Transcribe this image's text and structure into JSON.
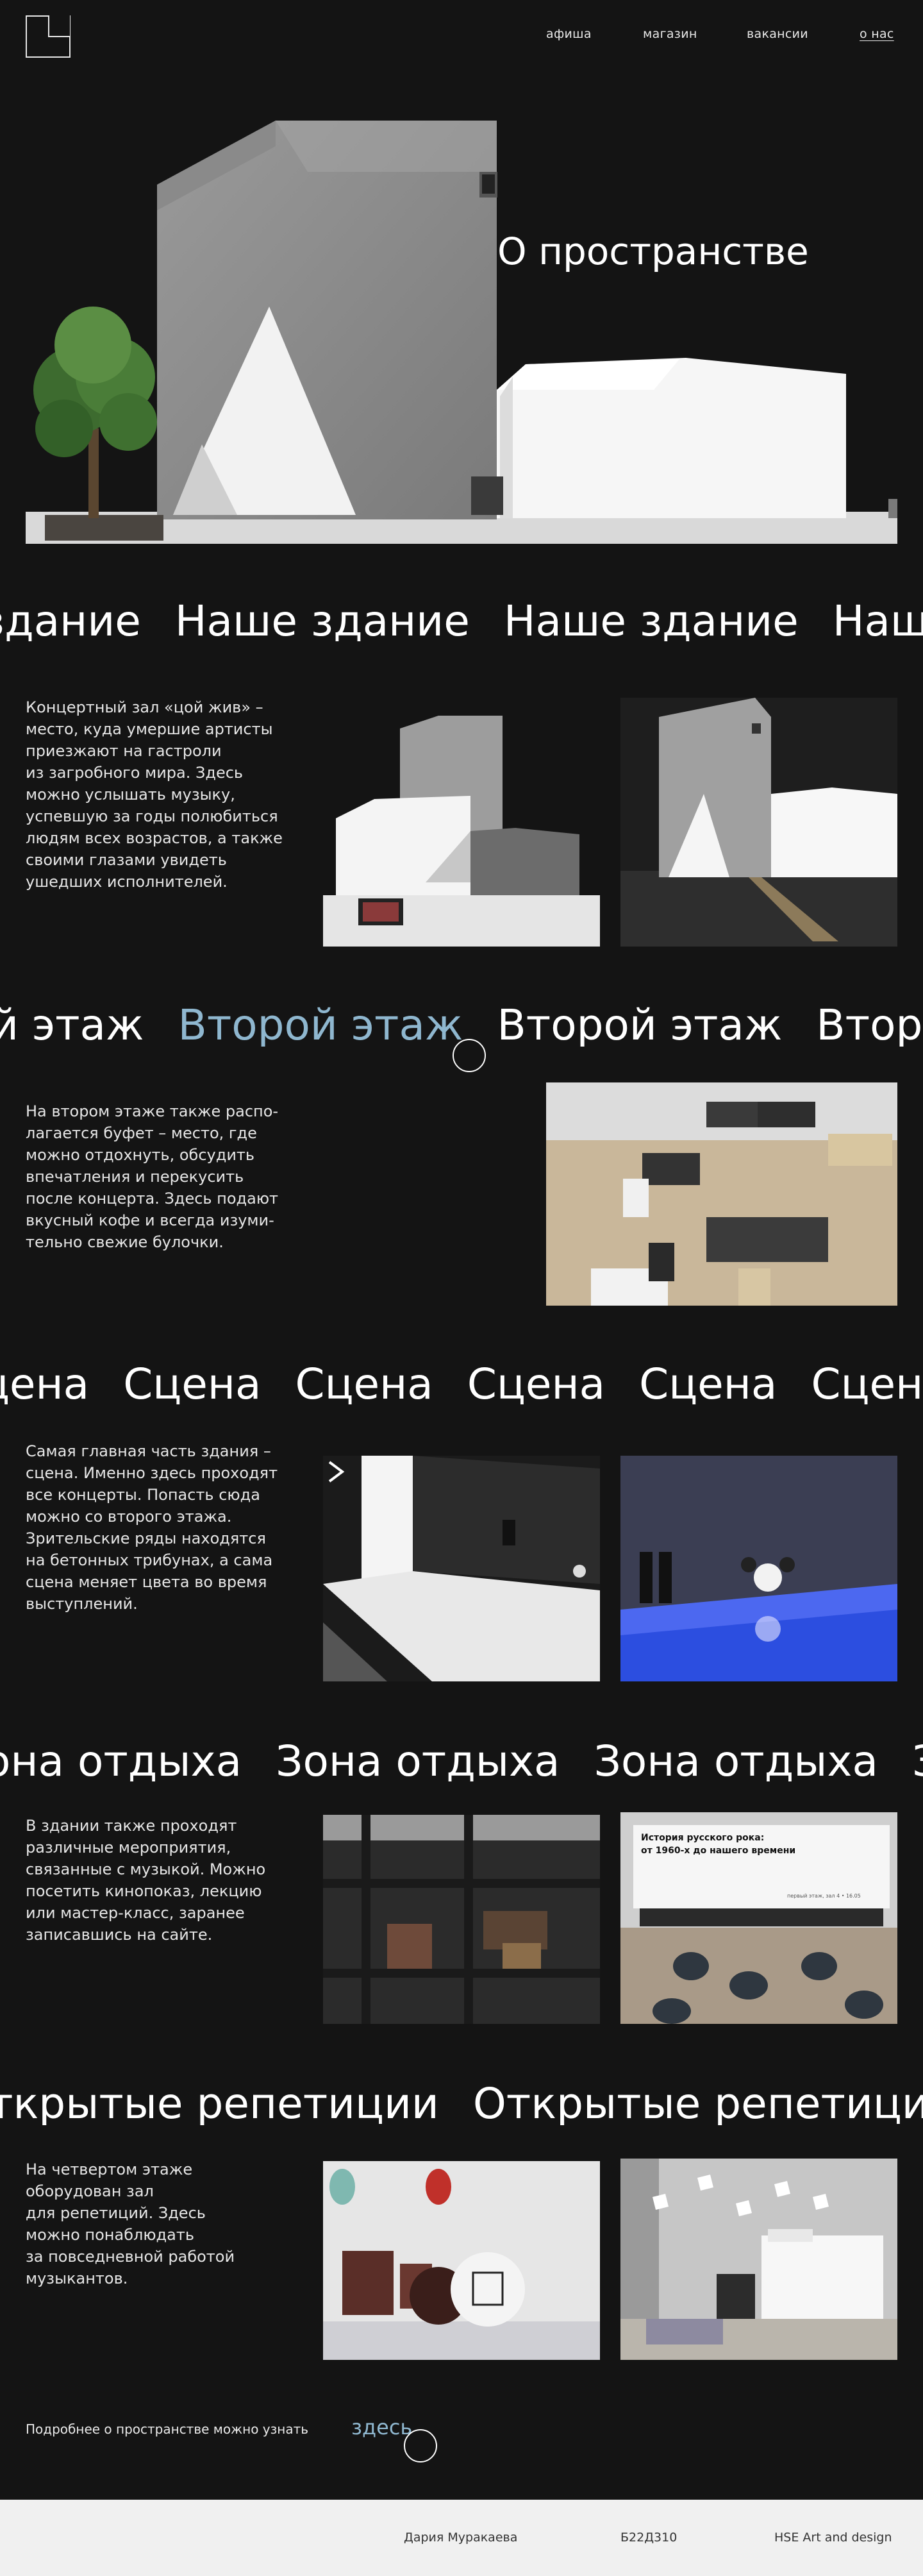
{
  "header": {
    "logo_name": "logo-mark",
    "nav": [
      {
        "label": "афиша",
        "active": false
      },
      {
        "label": "магазин",
        "active": false
      },
      {
        "label": "вакансии",
        "active": false
      },
      {
        "label": "о нас",
        "active": true
      }
    ]
  },
  "hero": {
    "title": "О пространстве"
  },
  "sections": {
    "building": {
      "marquee": [
        "здание",
        "Наше здание",
        "Наше здание",
        "Наше"
      ],
      "text": "Концертный зал «цой жив» –\nместо, куда умершие артисты\nприезжают на гастроли\nиз загробного мира. Здесь\nможно услышать музыку,\nуспевшую за годы полюбиться\nлюдям всех возрастов, а также\nсвоими глазами увидеть\nушедших исполнителей."
    },
    "second_floor": {
      "marquee": [
        "й этаж",
        "Второй этаж",
        "Второй этаж",
        "Второй"
      ],
      "text": "На втором этаже также распо-\nлагается буфет – место, где\nможно отдохнуть, обсудить\nвпечатления и перекусить\nпосле концерта. Здесь подают\nвкусный кофе и всегда изуми-\nтельно свежие булочки."
    },
    "stage": {
      "marquee": [
        "цена",
        "Сцена",
        "Сцена",
        "Сцена",
        "Сцена",
        "Сцен"
      ],
      "text": "Самая главная часть здания –\nсцена. Именно здесь проходят\nвсе концерты. Попасть сюда\nможно со второго этажа.\nЗрительские ряды находятся\nна бетонных трибунах, а сама\nсцена меняет цвета во время\nвыступлений."
    },
    "lounge": {
      "marquee": [
        "она отдыха",
        "Зона отдыха",
        "Зона отдыха",
        "Зо"
      ],
      "text": "В здании также проходят\nразличные мероприятия,\nсвязанные с музыкой. Можно\nпосетить кинопоказ, лекцию\nили мастер-класс, заранее\nзаписавшись на сайте.",
      "poster_title": "История русского рока:\nот 1960-х до нашего времени",
      "poster_small": "первый этаж, зал 4 • 16.05"
    },
    "rehearsals": {
      "marquee": [
        "ткрытые репетиции",
        "Открытые репетиции"
      ],
      "text": "На четвертом этаже\nоборудован зал\nдля репетиций. Здесь\nможно понаблюдать\nза повседневной работой\nмузыкантов."
    }
  },
  "more": {
    "text": "Подробнее о пространстве можно узнать",
    "link": "здесь"
  },
  "footer": {
    "author": "Дария Муракаева",
    "group": "Б22Д310",
    "program": "HSE Art and design"
  },
  "colors": {
    "background": "#141414",
    "accent": "#8fb7cf",
    "footer_bg": "#f0f0f0"
  }
}
